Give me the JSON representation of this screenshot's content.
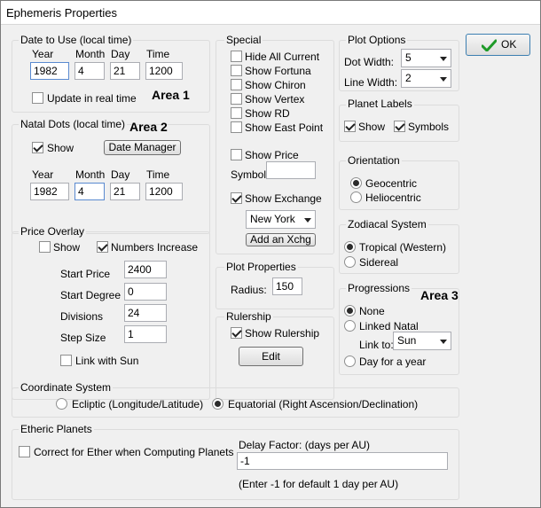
{
  "window": {
    "title": "Ephemeris Properties"
  },
  "ok_button": {
    "label": "OK"
  },
  "date_to_use": {
    "label": "Date to Use (local time)",
    "col_year": "Year",
    "col_month": "Month",
    "col_day": "Day",
    "col_time": "Time",
    "year": "1982",
    "month": "4",
    "day": "21",
    "time": "1200",
    "update_realtime": "Update in real time",
    "area": "Area 1"
  },
  "natal_dots": {
    "label": "Natal Dots (local time)",
    "area": "Area 2",
    "show": "Show",
    "date_manager": "Date Manager",
    "col_year": "Year",
    "col_month": "Month",
    "col_day": "Day",
    "col_time": "Time",
    "year": "1982",
    "month": "4",
    "day": "21",
    "time": "1200"
  },
  "price_overlay": {
    "label": "Price Overlay",
    "show": "Show",
    "numbers_increase": "Numbers Increase",
    "start_price_label": "Start Price",
    "start_price": "2400",
    "start_degree_label": "Start Degree",
    "start_degree": "0",
    "divisions_label": "Divisions",
    "divisions": "24",
    "step_size_label": "Step Size",
    "step_size": "1",
    "link_with_sun": "Link with Sun"
  },
  "special": {
    "label": "Special",
    "items": [
      "Hide All Current",
      "Show Fortuna",
      "Show Chiron",
      "Show Vertex",
      "Show RD",
      "Show East Point"
    ],
    "show_price": "Show Price",
    "symbol_label": "Symbol:",
    "symbol_value": "",
    "show_exchange": "Show Exchange",
    "exchange_value": "New York",
    "add_xchg": "Add an Xchg"
  },
  "plot_properties": {
    "label": "Plot Properties",
    "radius_label": "Radius:",
    "radius_value": "150"
  },
  "rulership": {
    "label": "Rulership",
    "show_rulership": "Show Rulership",
    "edit": "Edit"
  },
  "plot_options": {
    "label": "Plot Options",
    "dot_width_label": "Dot Width:",
    "dot_width": "5",
    "line_width_label": "Line Width:",
    "line_width": "2"
  },
  "planet_labels": {
    "label": "Planet Labels",
    "show": "Show",
    "symbols": "Symbols"
  },
  "orientation": {
    "label": "Orientation",
    "geocentric": "Geocentric",
    "heliocentric": "Heliocentric"
  },
  "zodiacal": {
    "label": "Zodiacal System",
    "tropical": "Tropical (Western)",
    "sidereal": "Sidereal"
  },
  "progressions": {
    "label": "Progressions",
    "area": "Area 3",
    "none": "None",
    "linked_natal": "Linked Natal",
    "link_to_label": "Link to:",
    "link_to_value": "Sun",
    "day_for_year": "Day for a year"
  },
  "coordinate_system": {
    "label": "Coordinate System",
    "ecliptic": "Ecliptic (Longitude/Latitude)",
    "equatorial": "Equatorial (Right Ascension/Declination)"
  },
  "etheric": {
    "label": "Etheric Planets",
    "correct": "Correct for Ether when Computing Planets",
    "delay_label": "Delay Factor: (days per AU)",
    "delay_value": "-1",
    "hint": "(Enter -1 for default 1 day per AU)"
  }
}
